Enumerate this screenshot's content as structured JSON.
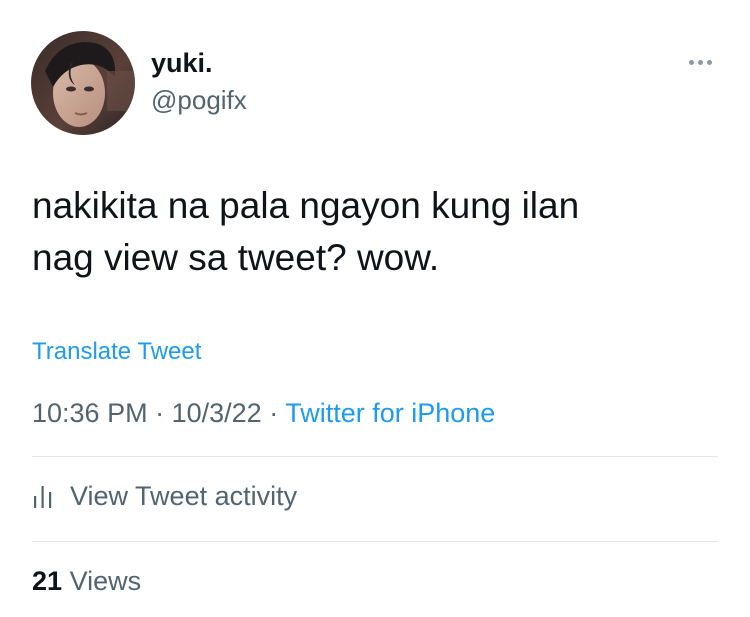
{
  "author": {
    "display_name": "yuki.",
    "handle": "@pogifx",
    "avatar_icon": "profile-photo"
  },
  "tweet": {
    "text_lines": [
      "nakikita na pala ngayon kung ilan",
      "nag view sa tweet? wow."
    ],
    "translate_label": "Translate Tweet"
  },
  "meta": {
    "time": "10:36 PM",
    "date": "10/3/22",
    "separator": "·",
    "source": "Twitter for iPhone"
  },
  "activity": {
    "icon": "bar-chart-icon",
    "label": "View Tweet activity"
  },
  "views": {
    "count": "21",
    "label": "Views"
  },
  "more_icon": "more-horizontal-icon",
  "colors": {
    "accent": "#1d9bf0",
    "text_primary": "#0f1419",
    "text_secondary": "#536471",
    "divider": "#e1e6ea"
  }
}
